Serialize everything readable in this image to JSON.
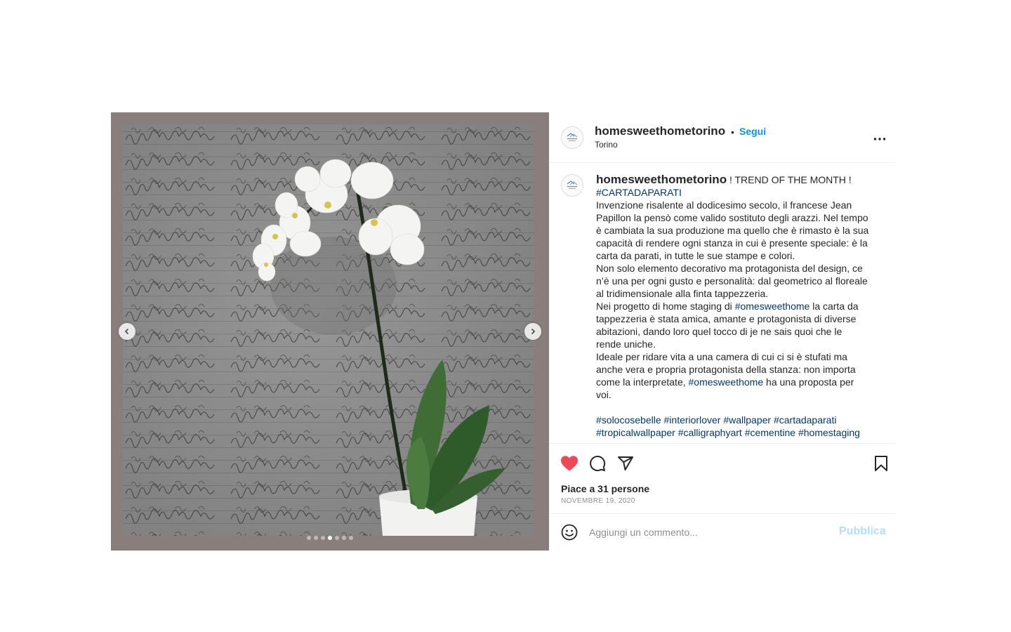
{
  "post": {
    "username": "homesweethometorino",
    "follow_label": "Segui",
    "separator": "•",
    "location": "Torino",
    "caption": {
      "username": "homesweethometorino",
      "headline": " ! TREND OF THE MONTH !",
      "hashtag_top": "#CARTADAPARATI",
      "lines": [
        "Invenzione risalente al dodicesimo secolo, il francese Jean",
        "Papillon la pensò come valido sostituto degli arazzi. Nel tempo",
        "è cambiata la sua produzione ma quello che è rimasto è la sua",
        "capacità di rendere ogni stanza in cui è presente speciale: è la",
        "carta da parati, in tutte le sue stampe e colori.",
        "Non solo elemento decorativo ma protagonista del design, ce",
        "n’è una per ogni gusto e personalità: dal geometrico al floreale",
        "al tridimensionale alla finta tappezzeria."
      ],
      "p3_before": "Nei progetto di home staging di ",
      "p3_tag": "#omesweethome",
      "p3_after": " la carta da",
      "p3_lines": [
        "tappezzeria è stata amica, amante e protagonista di diverse",
        "abitazioni, dando loro quel tocco di je ne sais quoi che le",
        "rende uniche."
      ],
      "p4_lines": [
        "Ideale per ridare vita a una camera di cui ci si è stufati ma",
        "anche vera e propria protagonista della stanza: non importa"
      ],
      "p4_before": "come la interpretate, ",
      "p4_tag": "#omesweethome",
      "p4_after": " ha una proposta per",
      "p4_end": "voi.",
      "tags_line1": [
        "#solocosebelle",
        "#interiorlover",
        "#wallpaper",
        "#cartadaparati"
      ],
      "tags_line2": [
        "#tropicalwallpaper",
        "#calligraphyart",
        "#cementine",
        "#homestaging"
      ]
    },
    "likes_text": "Piace a 31 persone",
    "date": "NOVEMBRE 19, 2020",
    "comment_placeholder": "Aggiungi un commento...",
    "publish_label": "Pubblica",
    "carousel": {
      "total": 7,
      "active_index": 3
    },
    "icons": {
      "like": "heart-filled-icon",
      "comment": "comment-bubble-icon",
      "share": "paper-plane-icon",
      "save": "bookmark-icon",
      "more": "more-dots-icon",
      "emoji": "emoji-face-icon"
    },
    "colors": {
      "like_red": "#ed4956",
      "link_blue": "#0095f6",
      "hashtag_blue": "#00376b",
      "publish_disabled": "#b2dffc"
    }
  }
}
